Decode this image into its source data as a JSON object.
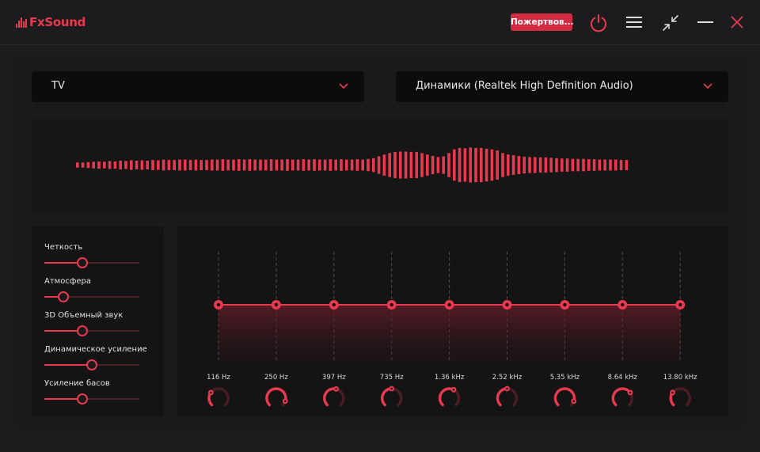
{
  "app": {
    "title": "FxSound"
  },
  "header": {
    "donate_label": "Пожертвов..."
  },
  "colors": {
    "accent": "#e8394f",
    "background": "#1c1c1e",
    "panel": "#141415"
  },
  "preset": {
    "selected": "TV"
  },
  "output_device": {
    "selected": "Динамики (Realtek High Definition Audio)"
  },
  "effects": [
    {
      "label": "Четкость",
      "value": 0.4
    },
    {
      "label": "Атмосфера",
      "value": 0.2
    },
    {
      "label": "3D Объемный звук",
      "value": 0.4
    },
    {
      "label": "Динамическое усиление",
      "value": 0.5
    },
    {
      "label": "Усиление басов",
      "value": 0.4
    }
  ],
  "equalizer": {
    "bands": [
      {
        "freq": "116 Hz",
        "gain": 0,
        "knob": 0.3
      },
      {
        "freq": "250 Hz",
        "gain": 0,
        "knob": 0.9
      },
      {
        "freq": "397 Hz",
        "gain": 0,
        "knob": 0.55
      },
      {
        "freq": "735 Hz",
        "gain": 0,
        "knob": 0.5
      },
      {
        "freq": "1.36 kHz",
        "gain": 0,
        "knob": 0.6
      },
      {
        "freq": "2.52 kHz",
        "gain": 0,
        "knob": 0.5
      },
      {
        "freq": "5.35 kHz",
        "gain": 0,
        "knob": 0.9
      },
      {
        "freq": "8.64 kHz",
        "gain": 0,
        "knob": 0.7
      },
      {
        "freq": "13.80 kHz",
        "gain": 0,
        "knob": 0.3
      }
    ]
  },
  "visualizer": {
    "levels": [
      0.14,
      0.14,
      0.16,
      0.18,
      0.2,
      0.18,
      0.22,
      0.2,
      0.24,
      0.22,
      0.26,
      0.24,
      0.26,
      0.24,
      0.28,
      0.26,
      0.3,
      0.28,
      0.28,
      0.3,
      0.3,
      0.28,
      0.3,
      0.28,
      0.28,
      0.3,
      0.3,
      0.32,
      0.3,
      0.3,
      0.32,
      0.3,
      0.32,
      0.3,
      0.3,
      0.3,
      0.32,
      0.3,
      0.3,
      0.32,
      0.3,
      0.3,
      0.32,
      0.3,
      0.32,
      0.3,
      0.3,
      0.32,
      0.3,
      0.32,
      0.3,
      0.3,
      0.32,
      0.3,
      0.34,
      0.38,
      0.48,
      0.58,
      0.66,
      0.72,
      0.74,
      0.74,
      0.72,
      0.72,
      0.66,
      0.58,
      0.5,
      0.44,
      0.48,
      0.66,
      0.86,
      0.94,
      0.92,
      0.96,
      0.94,
      0.94,
      0.9,
      0.86,
      0.8,
      0.66,
      0.58,
      0.54,
      0.5,
      0.46,
      0.44,
      0.44,
      0.42,
      0.42,
      0.4,
      0.38,
      0.36,
      0.36,
      0.34,
      0.34,
      0.34,
      0.32,
      0.32,
      0.3,
      0.3,
      0.3,
      0.3,
      0.28,
      0.28
    ]
  }
}
